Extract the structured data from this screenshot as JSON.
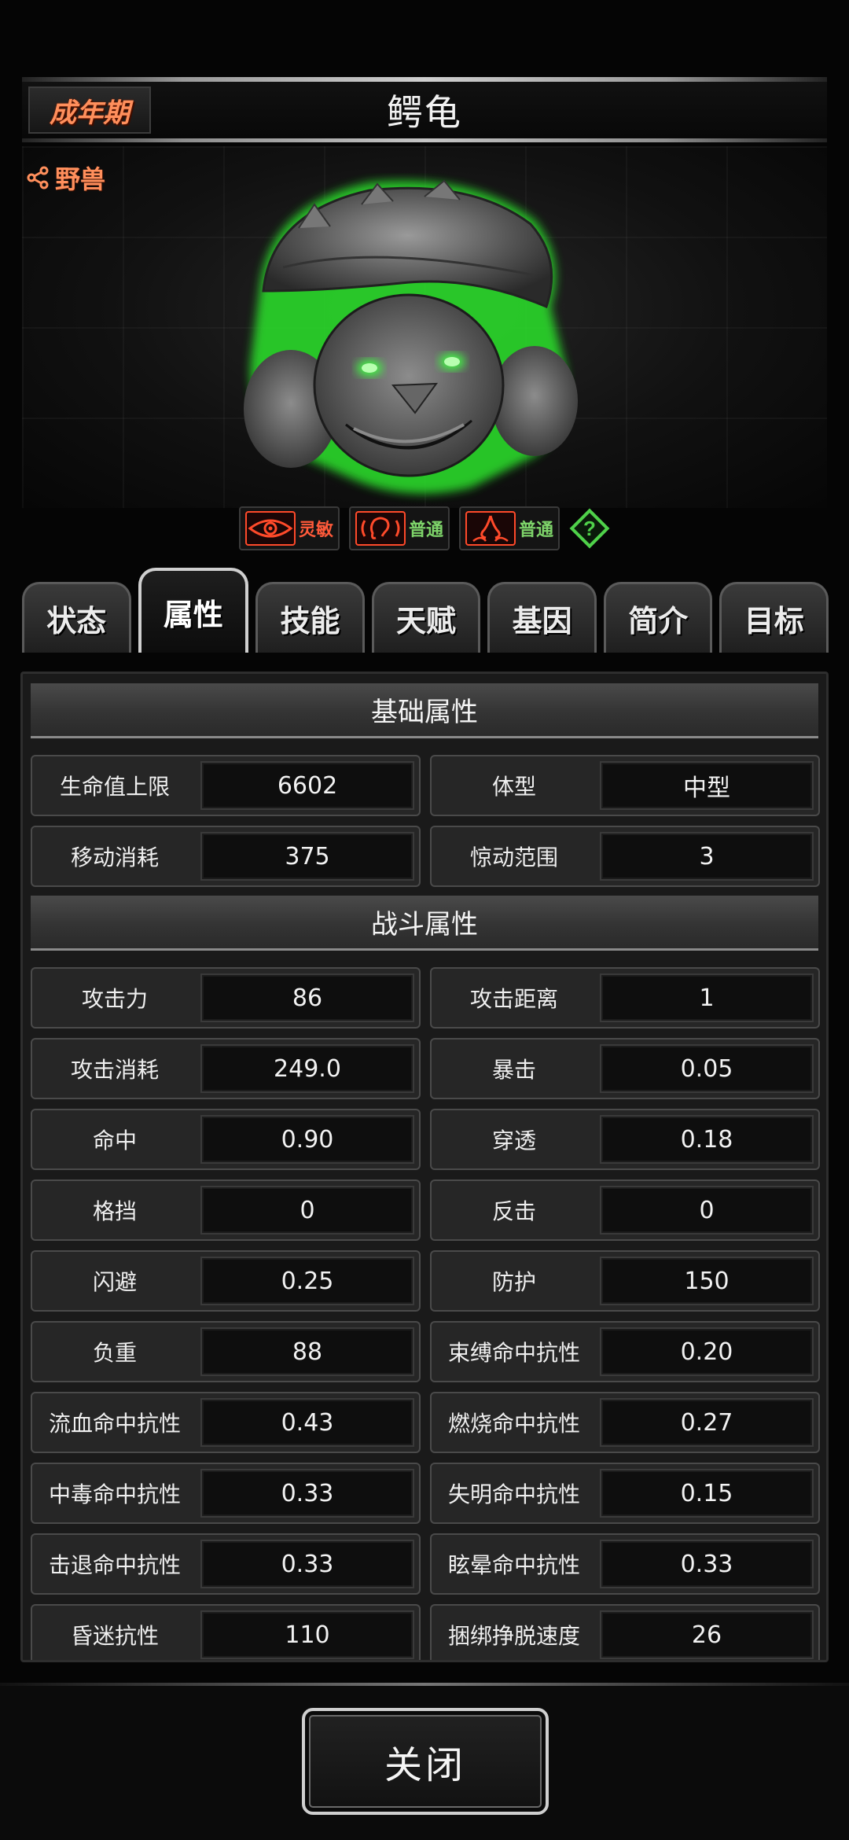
{
  "header": {
    "stage": "成年期",
    "creature_name": "鳄龟"
  },
  "portrait": {
    "type_tag": "野兽",
    "senses": [
      {
        "icon": "eye-icon",
        "label": "灵敏",
        "color": "#ff5a3a"
      },
      {
        "icon": "ear-icon",
        "label": "普通",
        "color": "#7ed46a"
      },
      {
        "icon": "nose-icon",
        "label": "普通",
        "color": "#7ed46a"
      }
    ]
  },
  "tabs": [
    {
      "label": "状态",
      "active": false
    },
    {
      "label": "属性",
      "active": true
    },
    {
      "label": "技能",
      "active": false
    },
    {
      "label": "天赋",
      "active": false
    },
    {
      "label": "基因",
      "active": false
    },
    {
      "label": "简介",
      "active": false
    },
    {
      "label": "目标",
      "active": false
    }
  ],
  "sections": {
    "basic": {
      "title": "基础属性",
      "stats": [
        {
          "name": "生命值上限",
          "value": "6602"
        },
        {
          "name": "体型",
          "value": "中型"
        },
        {
          "name": "移动消耗",
          "value": "375"
        },
        {
          "name": "惊动范围",
          "value": "3"
        }
      ]
    },
    "combat": {
      "title": "战斗属性",
      "stats": [
        {
          "name": "攻击力",
          "value": "86"
        },
        {
          "name": "攻击距离",
          "value": "1"
        },
        {
          "name": "攻击消耗",
          "value": "249.0"
        },
        {
          "name": "暴击",
          "value": "0.05"
        },
        {
          "name": "命中",
          "value": "0.90"
        },
        {
          "name": "穿透",
          "value": "0.18"
        },
        {
          "name": "格挡",
          "value": "0"
        },
        {
          "name": "反击",
          "value": "0"
        },
        {
          "name": "闪避",
          "value": "0.25"
        },
        {
          "name": "防护",
          "value": "150"
        },
        {
          "name": "负重",
          "value": "88"
        },
        {
          "name": "束缚命中抗性",
          "value": "0.20"
        },
        {
          "name": "流血命中抗性",
          "value": "0.43"
        },
        {
          "name": "燃烧命中抗性",
          "value": "0.27"
        },
        {
          "name": "中毒命中抗性",
          "value": "0.33"
        },
        {
          "name": "失明命中抗性",
          "value": "0.15"
        },
        {
          "name": "击退命中抗性",
          "value": "0.33"
        },
        {
          "name": "眩晕命中抗性",
          "value": "0.33"
        },
        {
          "name": "昏迷抗性",
          "value": "110"
        },
        {
          "name": "捆绑挣脱速度",
          "value": "26"
        }
      ]
    }
  },
  "footer": {
    "close_label": "关闭"
  },
  "colors": {
    "accent_orange": "#ff8f5c",
    "sense_red": "#ff5a3a",
    "sense_green": "#7ed46a",
    "glow_green": "#39ff3a"
  }
}
